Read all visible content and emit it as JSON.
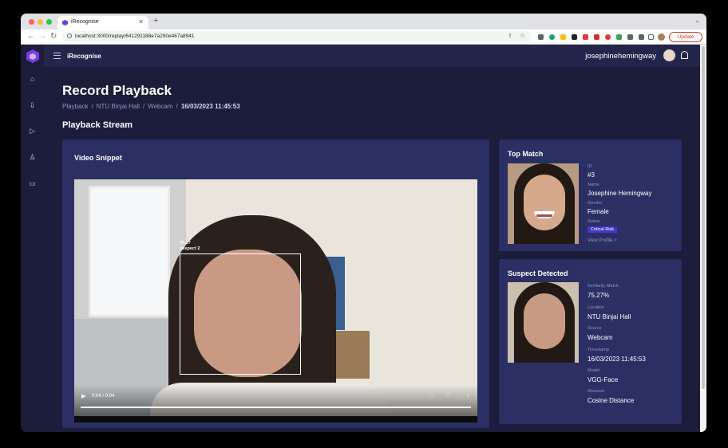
{
  "browser": {
    "tab_title": "iRecognise",
    "url": "localhost:3000/replay/641291188e7a290e467a8941",
    "update_label": "Update"
  },
  "app": {
    "title": "iRecognise",
    "username": "josephinehemingway"
  },
  "page": {
    "title": "Record Playback",
    "breadcrumb": [
      "Playback",
      "NTU Binjai Hall",
      "Webcam",
      "16/03/2023 11:45:53"
    ],
    "section_title": "Playback Stream"
  },
  "video_card": {
    "title": "Video Snippet",
    "detection_label_line1": "75.27",
    "detection_label_line2": "suspect 2",
    "time_display": "0:04 / 0:04",
    "progress": 1.0
  },
  "top_match": {
    "title": "Top Match",
    "fields": [
      {
        "label": "ID",
        "value": "#3"
      },
      {
        "label": "Name",
        "value": "Josephine Hemingway"
      },
      {
        "label": "Gender",
        "value": "Female"
      },
      {
        "label": "Status",
        "value": ""
      }
    ],
    "status_badge": "Critical Risk",
    "view_profile": "View Profile >"
  },
  "suspect": {
    "title": "Suspect Detected",
    "fields": [
      {
        "label": "Similarity Match",
        "value": "75.27%"
      },
      {
        "label": "Location",
        "value": "NTU Binjai Hall"
      },
      {
        "label": "Source",
        "value": "Webcam"
      },
      {
        "label": "Timestamp",
        "value": "16/03/2023 11:45:53"
      },
      {
        "label": "Model",
        "value": "VGG-Face"
      },
      {
        "label": "Measure",
        "value": "Cosine Distance"
      }
    ]
  },
  "colors": {
    "background": "#1b1d3a",
    "card": "#2c2f63",
    "accent": "#4338ca",
    "muted_text": "#8f94c4"
  }
}
